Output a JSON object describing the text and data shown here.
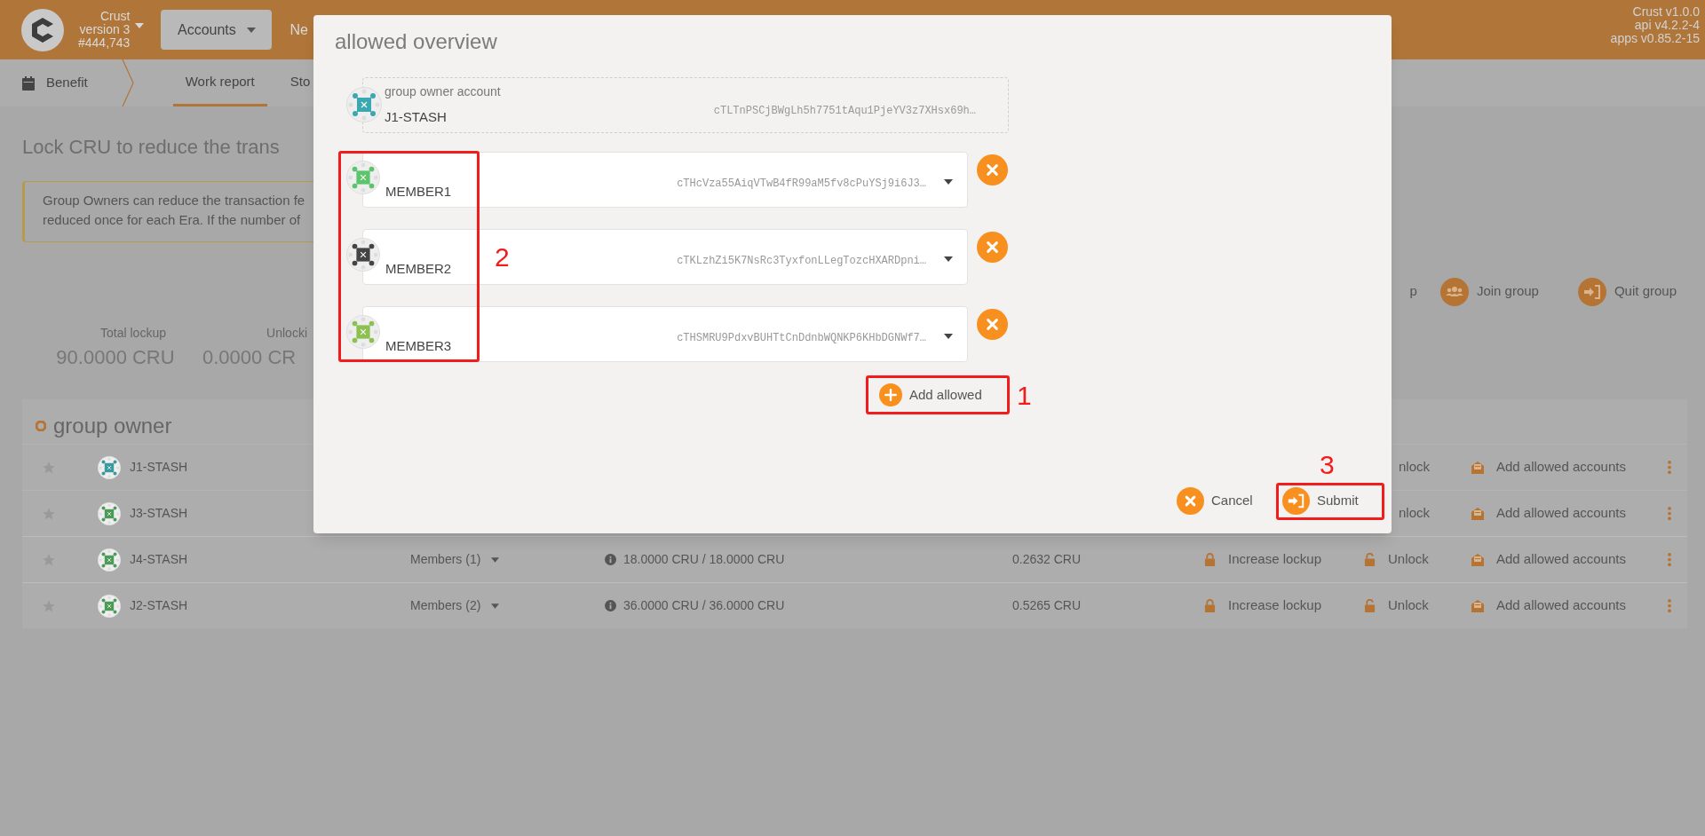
{
  "header": {
    "brand": {
      "name": "Crust",
      "version": "version 3",
      "block": "#444,743"
    },
    "nav": [
      {
        "label": "Accounts",
        "selected": true
      },
      {
        "label": "Ne",
        "selected": false
      }
    ],
    "versions": [
      "Crust v1.0.0",
      "api v4.2.2-4",
      "apps v0.85.2-15"
    ]
  },
  "subnav": {
    "section": "Benefit",
    "tabs": [
      {
        "label": "Work report",
        "selected": true
      },
      {
        "label": "Sto",
        "selected": false
      }
    ]
  },
  "heading": "Lock CRU to reduce the trans",
  "notice": [
    "Group Owners can reduce the transaction fe",
    "reduced once for each Era. If the number of"
  ],
  "actions": [
    {
      "label": "p"
    },
    {
      "label": "Join group"
    },
    {
      "label": "Quit group"
    }
  ],
  "stats": [
    {
      "label": "Total lockup",
      "value": "90.0000 CRU"
    },
    {
      "label": "Unlocki",
      "value": "0.0000 CR"
    }
  ],
  "group": {
    "title": "group owner",
    "rows": [
      {
        "name": "J1-STASH",
        "color": "#3a9aa0",
        "covered": true,
        "unlock": "nlock",
        "allowed": "Add allowed accounts"
      },
      {
        "name": "J3-STASH",
        "color": "#4e9a58",
        "covered": true,
        "unlock": "nlock",
        "allowed": "Add allowed accounts"
      },
      {
        "name": "J4-STASH",
        "color": "#4e9a58",
        "covered": false,
        "members": "Members (1)",
        "locked": "18.0000 CRU / 18.0000 CRU",
        "fee": "0.2632 CRU",
        "increase": "Increase lockup",
        "unlock": "Unlock",
        "allowed": "Add allowed accounts"
      },
      {
        "name": "J2-STASH",
        "color": "#4e9a58",
        "covered": false,
        "members": "Members (2)",
        "locked": "36.0000 CRU / 36.0000 CRU",
        "fee": "0.5265 CRU",
        "increase": "Increase lockup",
        "unlock": "Unlock",
        "allowed": "Add allowed accounts"
      }
    ]
  },
  "dialog": {
    "title": "allowed overview",
    "owner": {
      "label": "group owner account",
      "name": "J1-STASH",
      "address": "cTLTnPSCjBWgLh5h7751tAqu1PjeYV3z7XHsx69h…",
      "color": "#3aa8b0"
    },
    "members": [
      {
        "name": "MEMBER1",
        "address": "cTHcVza55AiqVTwB4fR99aM5fv8cPuYSj9i6J3…",
        "color": "#5cc46a"
      },
      {
        "name": "MEMBER2",
        "address": "cTKLzhZi5K7NsRc3TyxfonLLegTozcHXARDpni…",
        "color": "#444444"
      },
      {
        "name": "MEMBER3",
        "address": "cTHSMRU9PdxvBUHTtCnDdnbWQNKP6KHbDGNWf7…",
        "color": "#8cc152"
      }
    ],
    "add": "Add allowed",
    "cancel": "Cancel",
    "submit": "Submit"
  },
  "annotations": [
    {
      "label": "1"
    },
    {
      "label": "2"
    },
    {
      "label": "3"
    }
  ]
}
